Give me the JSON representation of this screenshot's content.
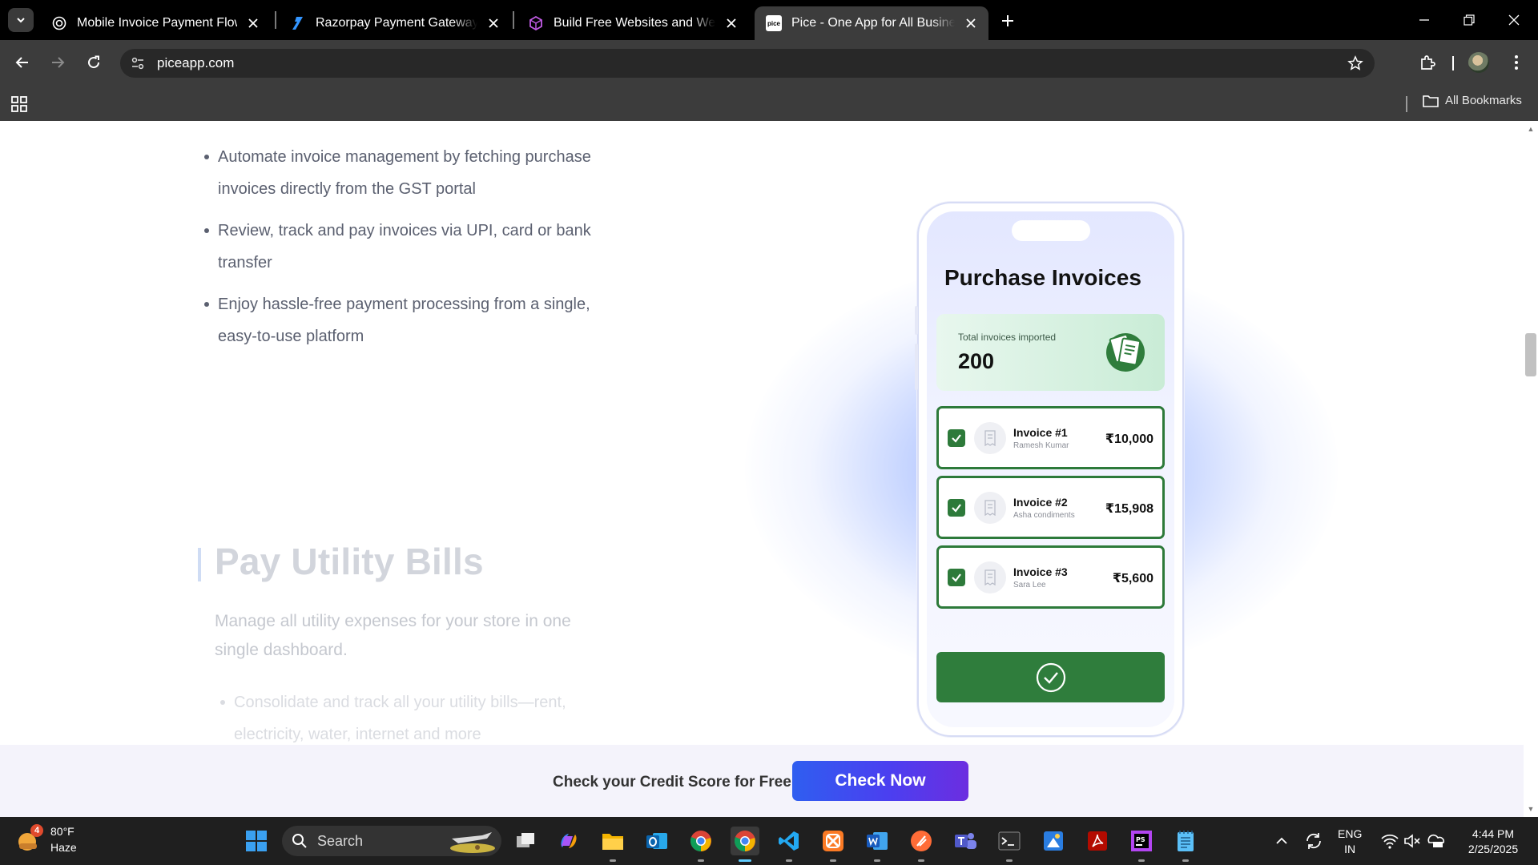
{
  "browser": {
    "tabs": [
      {
        "title": "Mobile Invoice Payment Flow",
        "icon": "openai-icon",
        "active": false
      },
      {
        "title": "Razorpay Payment Gateway Flow",
        "icon": "razorpay-icon",
        "active": false
      },
      {
        "title": "Build Free Websites and Webapps",
        "icon": "cube-icon",
        "active": false
      },
      {
        "title": "Pice - One App for All Business",
        "icon": "pice-icon",
        "active": true
      }
    ],
    "pice_favicon_text": "pice",
    "url": "piceapp.com",
    "bookmarks_label": "All Bookmarks"
  },
  "page": {
    "bullets": [
      "Automate invoice management by fetching purchase invoices directly from the GST portal",
      "Review, track and pay invoices via UPI, card or bank transfer",
      "Enjoy hassle-free payment processing from a single, easy-to-use platform"
    ],
    "section_title": "Pay Utility Bills",
    "section_description": "Manage all utility expenses for your store in one single dashboard.",
    "faded_bullets": [
      "Consolidate and track all your utility bills—rent, electricity, water, internet and more"
    ]
  },
  "phone": {
    "title": "Purchase Invoices",
    "total_label": "Total invoices imported",
    "total_value": "200",
    "invoices": [
      {
        "name": "Invoice #1",
        "party": "Ramesh Kumar",
        "amount": "₹10,000",
        "checked": true
      },
      {
        "name": "Invoice #2",
        "party": "Asha condiments",
        "amount": "₹15,908",
        "checked": true
      },
      {
        "name": "Invoice #3",
        "party": "Sara Lee",
        "amount": "₹5,600",
        "checked": true
      }
    ]
  },
  "banner": {
    "text": "Check your Credit Score for Free",
    "button": "Check Now"
  },
  "taskbar": {
    "weather": {
      "badge": "4",
      "temp": "80°F",
      "condition": "Haze"
    },
    "search_label": "Search",
    "apps": [
      "start-icon",
      "search-icon",
      "task-view-icon",
      "copilot-icon",
      "file-explorer-icon",
      "outlook-icon",
      "chrome-icon",
      "chrome-icon",
      "vscode-icon",
      "xampp-icon",
      "word-icon",
      "postman-icon",
      "teams-icon",
      "terminal-icon",
      "paint-icon",
      "acrobat-icon",
      "phpstorm-icon",
      "notepad-icon"
    ],
    "lang_top": "ENG",
    "lang_bottom": "IN",
    "time": "4:44 PM",
    "date": "2/25/2025"
  },
  "colors": {
    "accent_green": "#2d7a3a",
    "cta_gradient_start": "#2f5ef0",
    "cta_gradient_end": "#6c2ee0",
    "body_text": "#5b6070"
  }
}
